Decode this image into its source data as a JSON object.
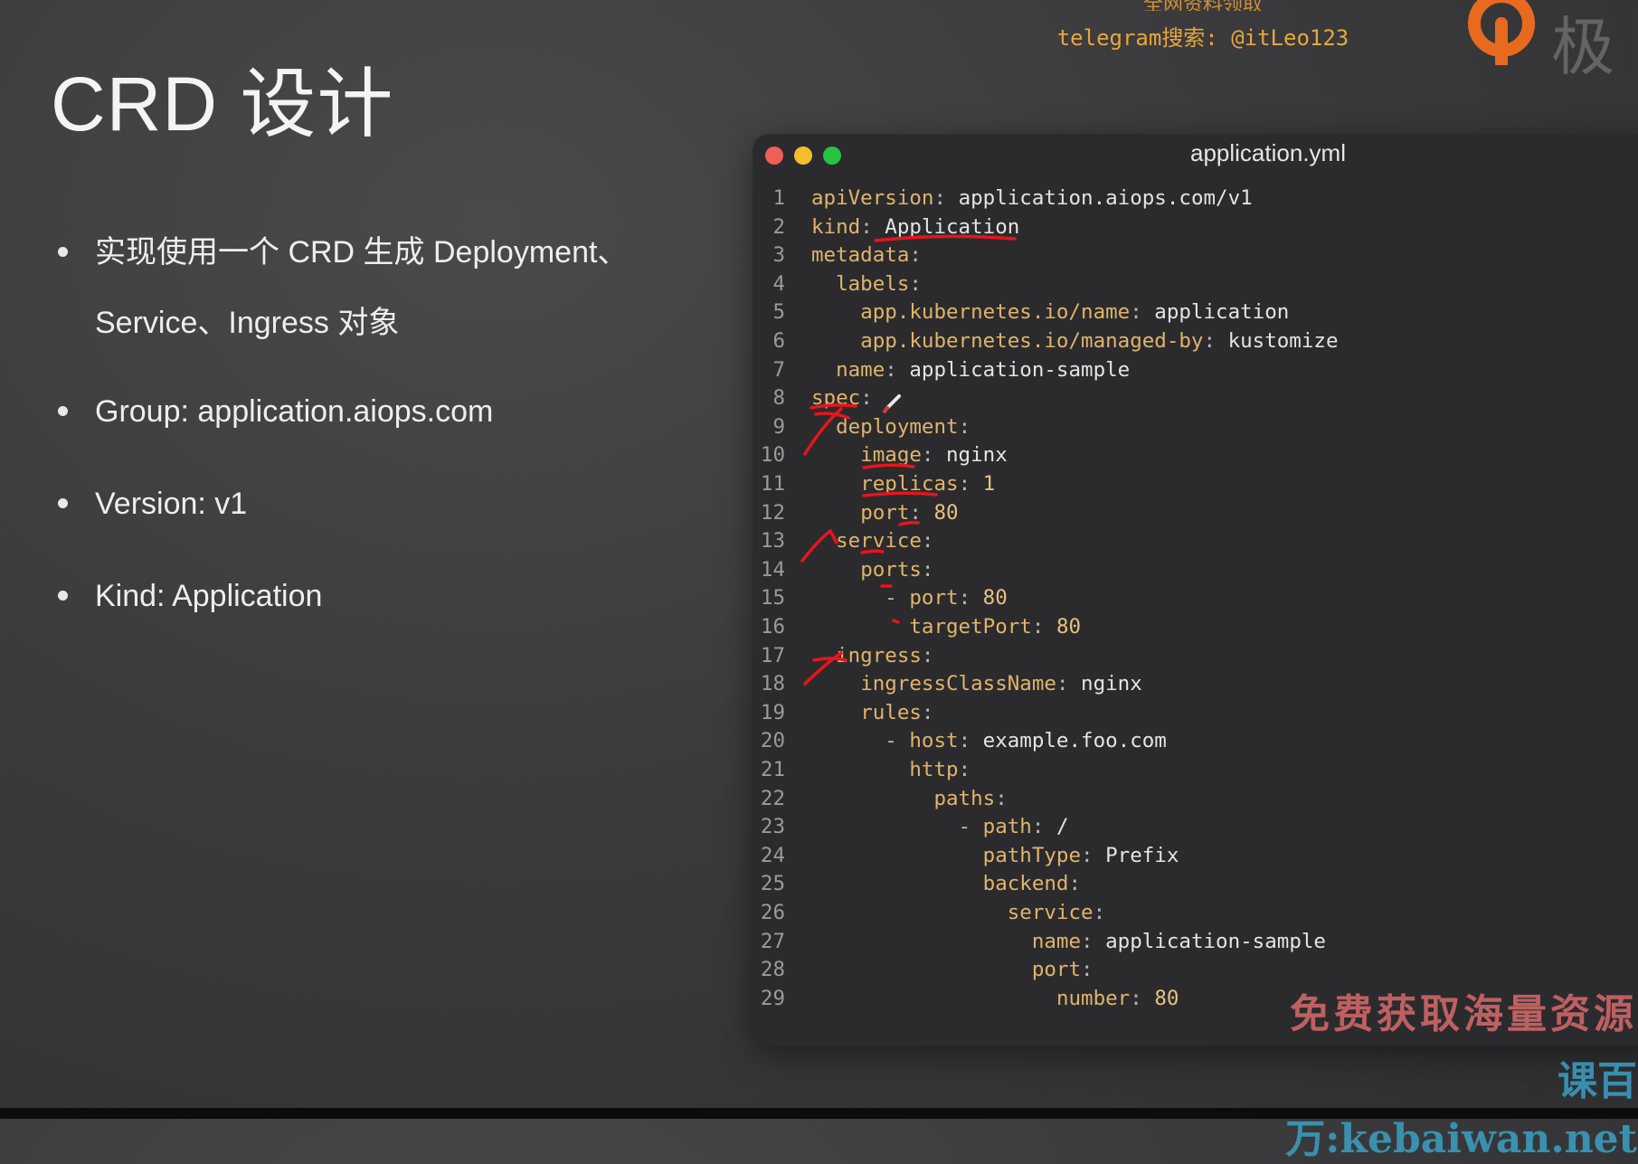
{
  "slide": {
    "title": "CRD 设计",
    "bullets": [
      "实现使用一个 CRD 生成 Deployment、Service、Ingress 对象",
      "Group: application.aiops.com",
      "Version: v1",
      "Kind: Application"
    ]
  },
  "watermark_top": {
    "line1": "全网资料领取",
    "line2": "telegram搜索: @itLeo123",
    "logo_text": "极"
  },
  "editor": {
    "file_name": "application.yml",
    "lines": [
      {
        "num": "1",
        "indent": "",
        "key": "apiVersion",
        "sep": ": ",
        "val": "application.aiops.com/v1"
      },
      {
        "num": "2",
        "indent": "",
        "key": "kind",
        "sep": ": ",
        "val": "Application"
      },
      {
        "num": "3",
        "indent": "",
        "key": "metadata",
        "sep": ":",
        "val": ""
      },
      {
        "num": "4",
        "indent": "  ",
        "key": "labels",
        "sep": ":",
        "val": ""
      },
      {
        "num": "5",
        "indent": "    ",
        "key": "app.kubernetes.io/name",
        "sep": ": ",
        "val": "application"
      },
      {
        "num": "6",
        "indent": "    ",
        "key": "app.kubernetes.io/managed-by",
        "sep": ": ",
        "val": "kustomize"
      },
      {
        "num": "7",
        "indent": "  ",
        "key": "name",
        "sep": ": ",
        "val": "application-sample"
      },
      {
        "num": "8",
        "indent": "",
        "key": "spec",
        "sep": ":",
        "val": ""
      },
      {
        "num": "9",
        "indent": "  ",
        "key": "deployment",
        "sep": ":",
        "val": ""
      },
      {
        "num": "10",
        "indent": "    ",
        "key": "image",
        "sep": ": ",
        "val": "nginx"
      },
      {
        "num": "11",
        "indent": "    ",
        "key": "replicas",
        "sep": ": ",
        "val": "1"
      },
      {
        "num": "12",
        "indent": "    ",
        "key": "port",
        "sep": ": ",
        "val": "80"
      },
      {
        "num": "13",
        "indent": "  ",
        "key": "service",
        "sep": ":",
        "val": ""
      },
      {
        "num": "14",
        "indent": "    ",
        "key": "ports",
        "sep": ":",
        "val": ""
      },
      {
        "num": "15",
        "indent": "      - ",
        "key": "port",
        "sep": ": ",
        "val": "80"
      },
      {
        "num": "16",
        "indent": "        ",
        "key": "targetPort",
        "sep": ": ",
        "val": "80"
      },
      {
        "num": "17",
        "indent": "  ",
        "key": "ingress",
        "sep": ":",
        "val": ""
      },
      {
        "num": "18",
        "indent": "    ",
        "key": "ingressClassName",
        "sep": ": ",
        "val": "nginx"
      },
      {
        "num": "19",
        "indent": "    ",
        "key": "rules",
        "sep": ":",
        "val": ""
      },
      {
        "num": "20",
        "indent": "      - ",
        "key": "host",
        "sep": ": ",
        "val": "example.foo.com"
      },
      {
        "num": "21",
        "indent": "        ",
        "key": "http",
        "sep": ":",
        "val": ""
      },
      {
        "num": "22",
        "indent": "          ",
        "key": "paths",
        "sep": ":",
        "val": ""
      },
      {
        "num": "23",
        "indent": "            - ",
        "key": "path",
        "sep": ": ",
        "val": "/"
      },
      {
        "num": "24",
        "indent": "              ",
        "key": "pathType",
        "sep": ": ",
        "val": "Prefix"
      },
      {
        "num": "25",
        "indent": "              ",
        "key": "backend",
        "sep": ":",
        "val": ""
      },
      {
        "num": "26",
        "indent": "                ",
        "key": "service",
        "sep": ":",
        "val": ""
      },
      {
        "num": "27",
        "indent": "                  ",
        "key": "name",
        "sep": ": ",
        "val": "application-sample"
      },
      {
        "num": "28",
        "indent": "                  ",
        "key": "port",
        "sep": ":",
        "val": ""
      },
      {
        "num": "29",
        "indent": "                    ",
        "key": "number",
        "sep": ": ",
        "val": "80"
      }
    ]
  },
  "watermark_bottom": {
    "line1": "免费获取海量资源",
    "line2": "课百万:kebaiwan.net"
  },
  "colors": {
    "key": "#e0b46a",
    "value": "#e4e4e4",
    "line_number": "#9a9a9a",
    "annotation": "#e8141c",
    "accent_orange": "#e7a63c"
  }
}
